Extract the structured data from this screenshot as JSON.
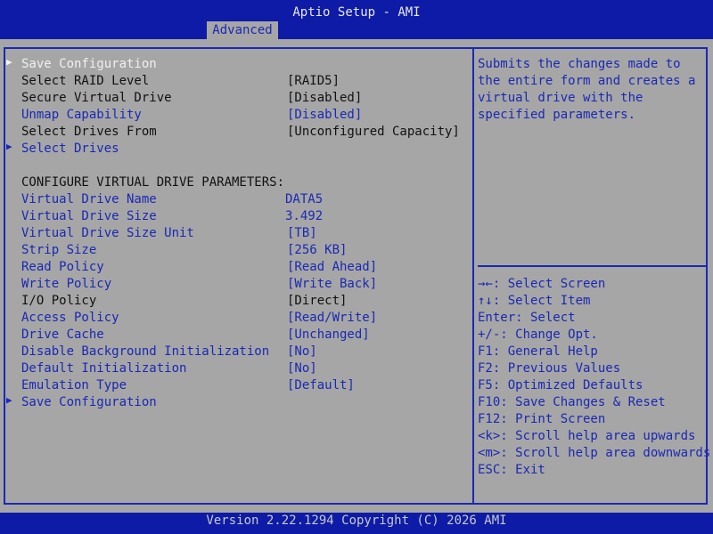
{
  "header": {
    "title": "Aptio Setup - AMI",
    "tab": "Advanced"
  },
  "menu": {
    "items": [
      {
        "label": "Save Configuration",
        "value": "",
        "color": "white",
        "arrow": true
      },
      {
        "label": "Select RAID Level",
        "value": "[RAID5]",
        "color": "black",
        "arrow": false
      },
      {
        "label": "Secure Virtual Drive",
        "value": "[Disabled]",
        "color": "black",
        "arrow": false
      },
      {
        "label": "Unmap Capability",
        "value": "[Disabled]",
        "color": "blue",
        "arrow": false
      },
      {
        "label": "Select Drives From",
        "value": "[Unconfigured Capacity]",
        "color": "black",
        "arrow": false
      },
      {
        "label": "Select Drives",
        "value": "",
        "color": "blue",
        "arrow": true
      },
      {
        "label": "CONFIGURE VIRTUAL DRIVE PARAMETERS:",
        "value": "",
        "color": "black",
        "arrow": false
      },
      {
        "label": "Virtual Drive Name",
        "value": "DATA5",
        "color": "blue",
        "arrow": false
      },
      {
        "label": "Virtual Drive Size",
        "value": "3.492",
        "color": "blue",
        "arrow": false
      },
      {
        "label": "Virtual Drive Size Unit",
        "value": "[TB]",
        "color": "blue",
        "arrow": false
      },
      {
        "label": "Strip Size",
        "value": "[256 KB]",
        "color": "blue",
        "arrow": false
      },
      {
        "label": "Read Policy",
        "value": "[Read Ahead]",
        "color": "blue",
        "arrow": false
      },
      {
        "label": "Write Policy",
        "value": "[Write Back]",
        "color": "blue",
        "arrow": false
      },
      {
        "label": "I/O Policy",
        "value": "[Direct]",
        "color": "black",
        "arrow": false
      },
      {
        "label": "Access Policy",
        "value": "[Read/Write]",
        "color": "blue",
        "arrow": false
      },
      {
        "label": "Drive Cache",
        "value": "[Unchanged]",
        "color": "blue",
        "arrow": false
      },
      {
        "label": "Disable Background Initialization",
        "value": "[No]",
        "color": "blue",
        "arrow": false
      },
      {
        "label": "Default Initialization",
        "value": "[No]",
        "color": "blue",
        "arrow": false
      },
      {
        "label": "Emulation Type",
        "value": "[Default]",
        "color": "blue",
        "arrow": false
      },
      {
        "label": "Save Configuration",
        "value": "",
        "color": "blue",
        "arrow": true
      }
    ]
  },
  "help": {
    "lines": [
      "Submits the changes made to",
      "the entire form and creates a",
      "virtual drive with the",
      "specified parameters."
    ]
  },
  "keys": {
    "lines": [
      "→←: Select Screen",
      "↑↓: Select Item",
      "Enter: Select",
      "+/-: Change Opt.",
      "F1: General Help",
      "F2: Previous Values",
      "F5: Optimized Defaults",
      "F10: Save Changes & Reset",
      "F12: Print Screen",
      "<k>: Scroll help area upwards",
      "<m>: Scroll help area downwards",
      "ESC: Exit"
    ]
  },
  "footer": {
    "text": "Version 2.22.1294 Copyright (C) 2026 AMI"
  },
  "colors": {
    "bg_blue": "#0d1ba6",
    "panel_gray": "#a6a6a6",
    "text_blue": "#1a28b5"
  }
}
